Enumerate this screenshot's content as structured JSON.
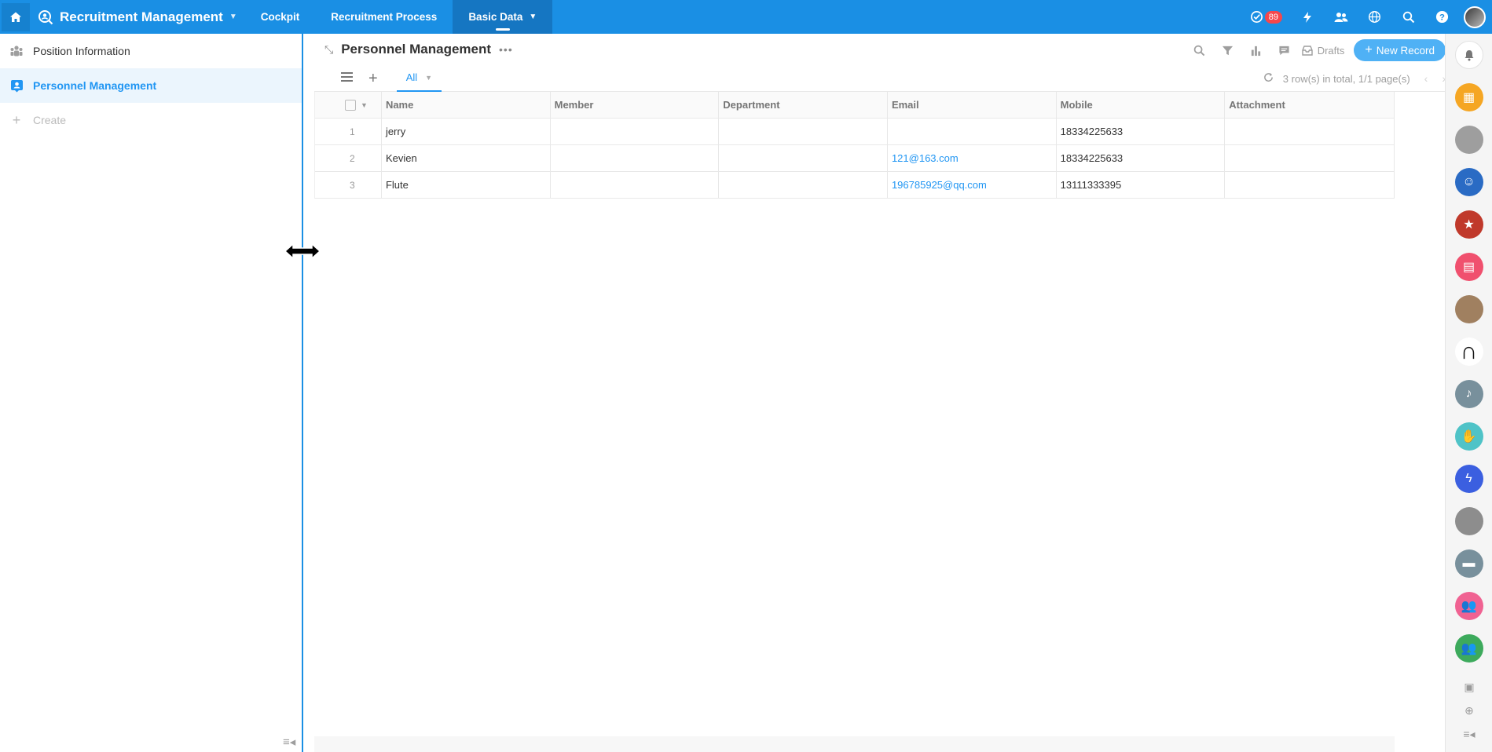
{
  "topbar": {
    "app_title": "Recruitment Management",
    "tabs": [
      {
        "label": "Cockpit"
      },
      {
        "label": "Recruitment Process"
      },
      {
        "label": "Basic Data"
      }
    ],
    "task_badge": "89",
    "accent_color": "#1a8fe4"
  },
  "sidebar": {
    "items": [
      {
        "label": "Position Information",
        "icon": "team-icon"
      },
      {
        "label": "Personnel Management",
        "icon": "person-card-icon"
      }
    ],
    "create_label": "Create"
  },
  "main": {
    "title": "Personnel Management",
    "drafts_label": "Drafts",
    "new_record_label": "New Record",
    "view_tab": "All",
    "pager_text": "3 row(s) in total, 1/1 page(s)",
    "columns": [
      "Name",
      "Member",
      "Department",
      "Email",
      "Mobile",
      "Attachment"
    ],
    "rows": [
      {
        "num": "1",
        "name": "jerry",
        "member": "",
        "department": "",
        "email": "",
        "mobile": "18334225633",
        "attachment": ""
      },
      {
        "num": "2",
        "name": "Kevien",
        "member": "",
        "department": "",
        "email": "121@163.com",
        "mobile": "18334225633",
        "attachment": ""
      },
      {
        "num": "3",
        "name": "Flute",
        "member": "",
        "department": "",
        "email": "196785925@qq.com",
        "mobile": "13111333395",
        "attachment": ""
      }
    ]
  },
  "rightbar": {
    "apps": [
      {
        "name": "grid-app-icon",
        "color": "#f5a623"
      },
      {
        "name": "apple-icon",
        "color": "#9e9e9e"
      },
      {
        "name": "cartoon-avatar-icon",
        "color": "#2a6bc4"
      },
      {
        "name": "shield-star-icon",
        "color": "#c0392b"
      },
      {
        "name": "calendar-icon",
        "color": "#f0506e"
      },
      {
        "name": "photo-avatar-icon",
        "color": "#a08060"
      },
      {
        "name": "n-logo-icon",
        "color": "#ffffff"
      },
      {
        "name": "bell-app-icon",
        "color": "#78909c"
      },
      {
        "name": "art-avatar-icon",
        "color": "#4fc3c7"
      },
      {
        "name": "bolt-app-icon",
        "color": "#3b5fe0"
      },
      {
        "name": "person-avatar-icon",
        "color": "#8d8d8d"
      },
      {
        "name": "briefcase-icon",
        "color": "#78909c"
      },
      {
        "name": "group-pink-icon",
        "color": "#f06292"
      },
      {
        "name": "group-green-icon",
        "color": "#3daa5c"
      }
    ]
  }
}
